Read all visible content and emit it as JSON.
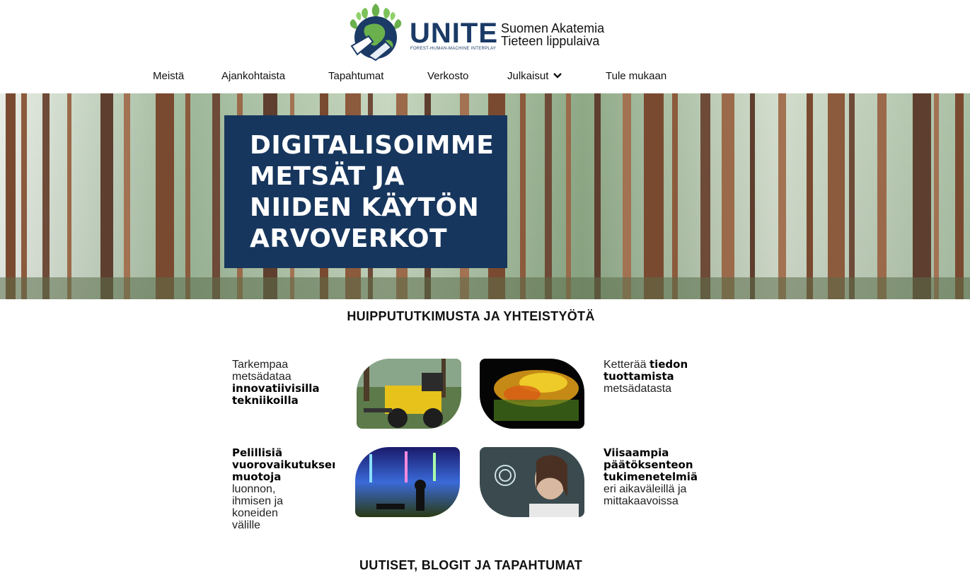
{
  "brand": {
    "logo_text": "UNITE",
    "logo_subtitle": "FOREST-HUMAN-MACHINE INTERPLAY",
    "tagline_line1": "Suomen Akatemia",
    "tagline_line2": "Tieteen lippulaiva"
  },
  "nav": {
    "items": [
      {
        "label": "Meistä"
      },
      {
        "label": "Ajankohtaista"
      },
      {
        "label": "Tapahtumat"
      },
      {
        "label": "Verkosto"
      },
      {
        "label": "Julkaisut"
      },
      {
        "label": "Tule mukaan"
      }
    ]
  },
  "hero": {
    "lines": [
      "DIGITALISOIMME",
      "METSÄT JA",
      "NIIDEN KÄYTÖN",
      "ARVOVERKOT"
    ]
  },
  "research": {
    "title": "HUIPPUTUTKIMUSTA JA YHTEISTYÖTÄ",
    "features": [
      {
        "pre": "Tarkempaa metsädataa",
        "bold": "innovatiivisilla tekniikoilla",
        "post": ""
      },
      {
        "pre": "Ketterää ",
        "bold": "tiedon tuottamista",
        "post": "metsädatasta"
      },
      {
        "pre": "",
        "bold": "Pelillisiä vuorovaikutuksen muotoja",
        "post": "luonnon, ihmisen ja koneiden välille"
      },
      {
        "pre": "",
        "bold": "Viisaampia päätöksenteon tukimenetelmiä",
        "post": "eri aikaväleillä ja mittakaavoissa"
      }
    ]
  },
  "news": {
    "title": "UUTISET, BLOGIT JA TAPAHTUMAT"
  },
  "colors": {
    "navy": "#17365d",
    "brand_green": "#6ab04c"
  }
}
